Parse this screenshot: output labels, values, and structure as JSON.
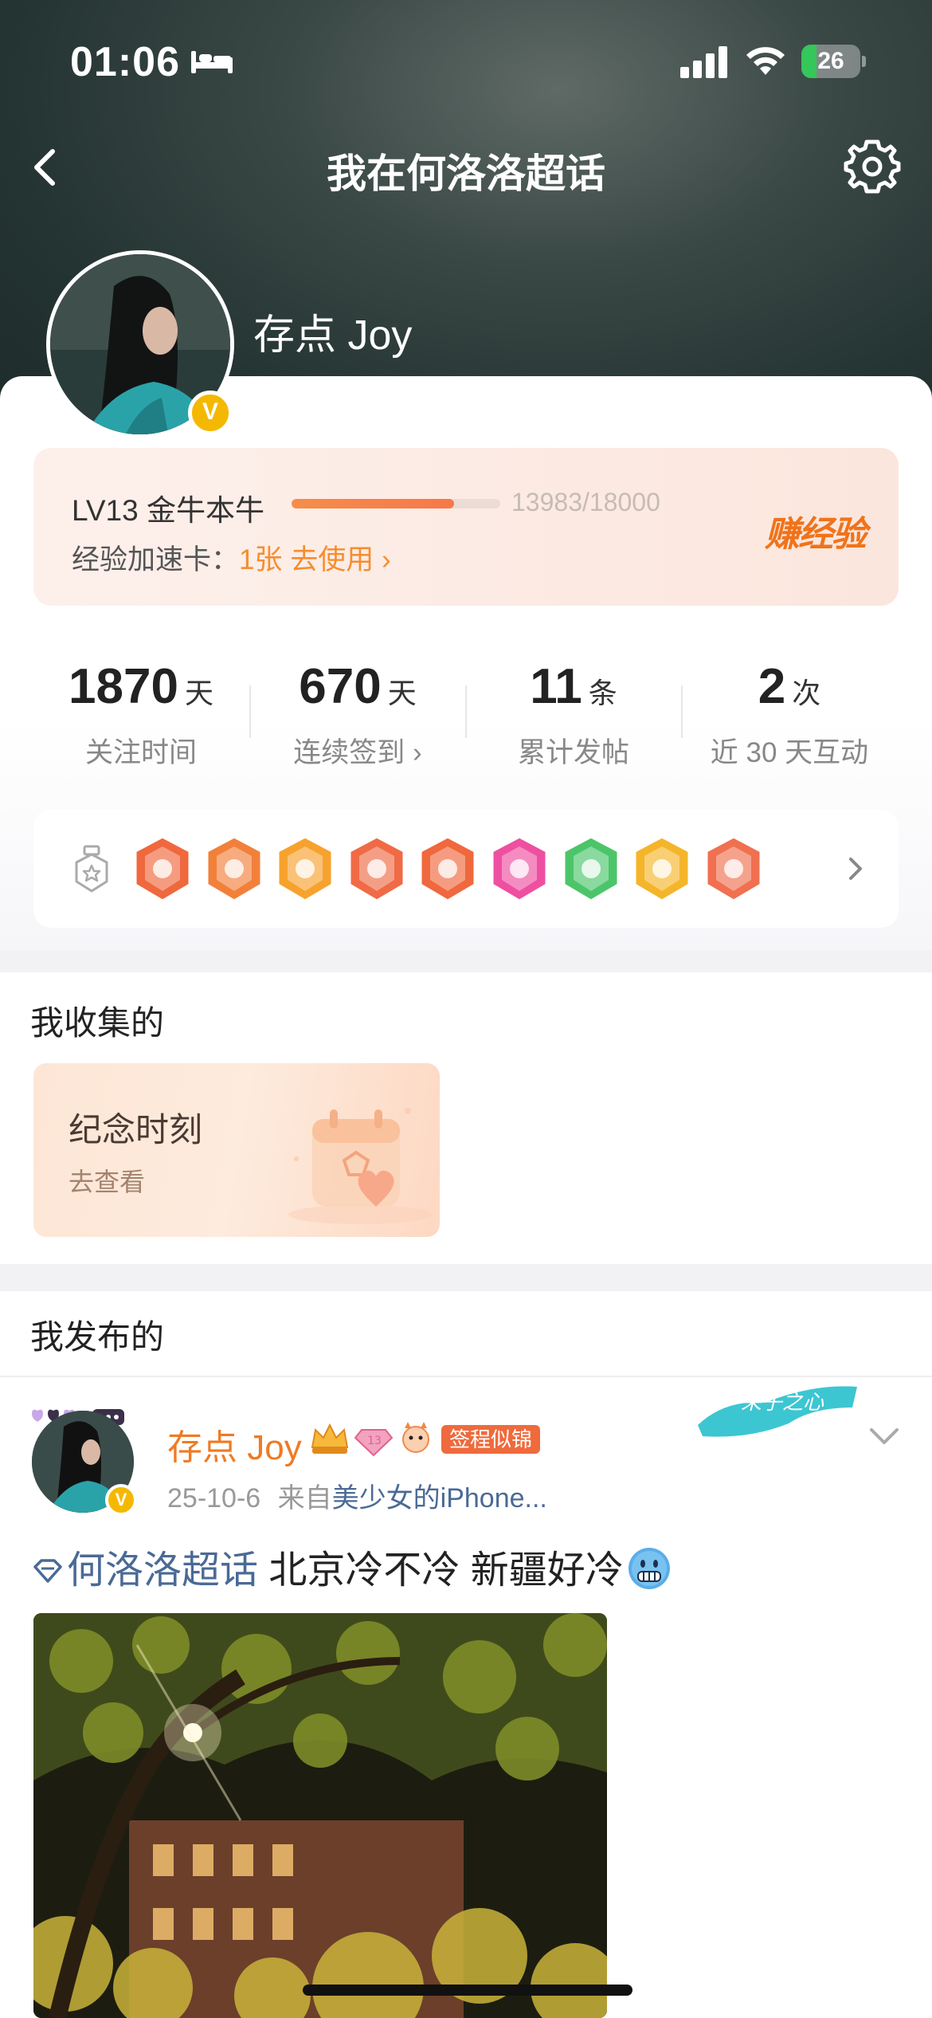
{
  "status_bar": {
    "time": "01:06",
    "battery": "26",
    "battery_level": 0.26
  },
  "nav": {
    "title": "我在何洛洛超话"
  },
  "profile": {
    "name": "存点 Joy",
    "verified_mark": "V"
  },
  "level_card": {
    "level_title": "LV13 金牛本牛",
    "exp_text": "13983/18000",
    "exp_progress": 0.7768,
    "boost_label": "经验加速卡：",
    "boost_count": "1张",
    "boost_use": "去使用 ›",
    "earn_button": "赚经验"
  },
  "stats": [
    {
      "value": "1870",
      "unit": "天",
      "label": "关注时间"
    },
    {
      "value": "670",
      "unit": "天",
      "label": "连续签到 ›"
    },
    {
      "value": "11",
      "unit": "条",
      "label": "累计发帖"
    },
    {
      "value": "2",
      "unit": "次",
      "label": "近 30 天互动"
    }
  ],
  "badges": {
    "items": [
      "bull-badge-icon",
      "100-days-badge-icon",
      "crown-badge-icon",
      "bull-face-badge-icon",
      "bull-king-badge-icon",
      "lv13-badge-icon",
      "hand-badge-icon",
      "30-days-badge-icon",
      "rock-hand-badge-icon"
    ],
    "colors": [
      "#f0683d",
      "#f2803a",
      "#f7a22e",
      "#f06a45",
      "#f0683d",
      "#ef4fa0",
      "#4cc56a",
      "#f5b52a",
      "#f07050"
    ]
  },
  "collect": {
    "title": "我收集的",
    "card_title": "纪念时刻",
    "card_sub": "去查看"
  },
  "posts": {
    "title": "我发布的",
    "author": "存点 Joy",
    "tag": "签程似锦",
    "date": "25-10-6",
    "source_prefix": "来自",
    "source": "美少女的iPhone...",
    "topic": "何洛洛超话",
    "text": " 北京冷不冷 新疆好冷",
    "level_badge": "13",
    "sticker_text": "采子之心"
  },
  "colors": {
    "accent_orange": "#f07a23",
    "link_blue": "#4a6a96",
    "header_dark": "#243432"
  }
}
